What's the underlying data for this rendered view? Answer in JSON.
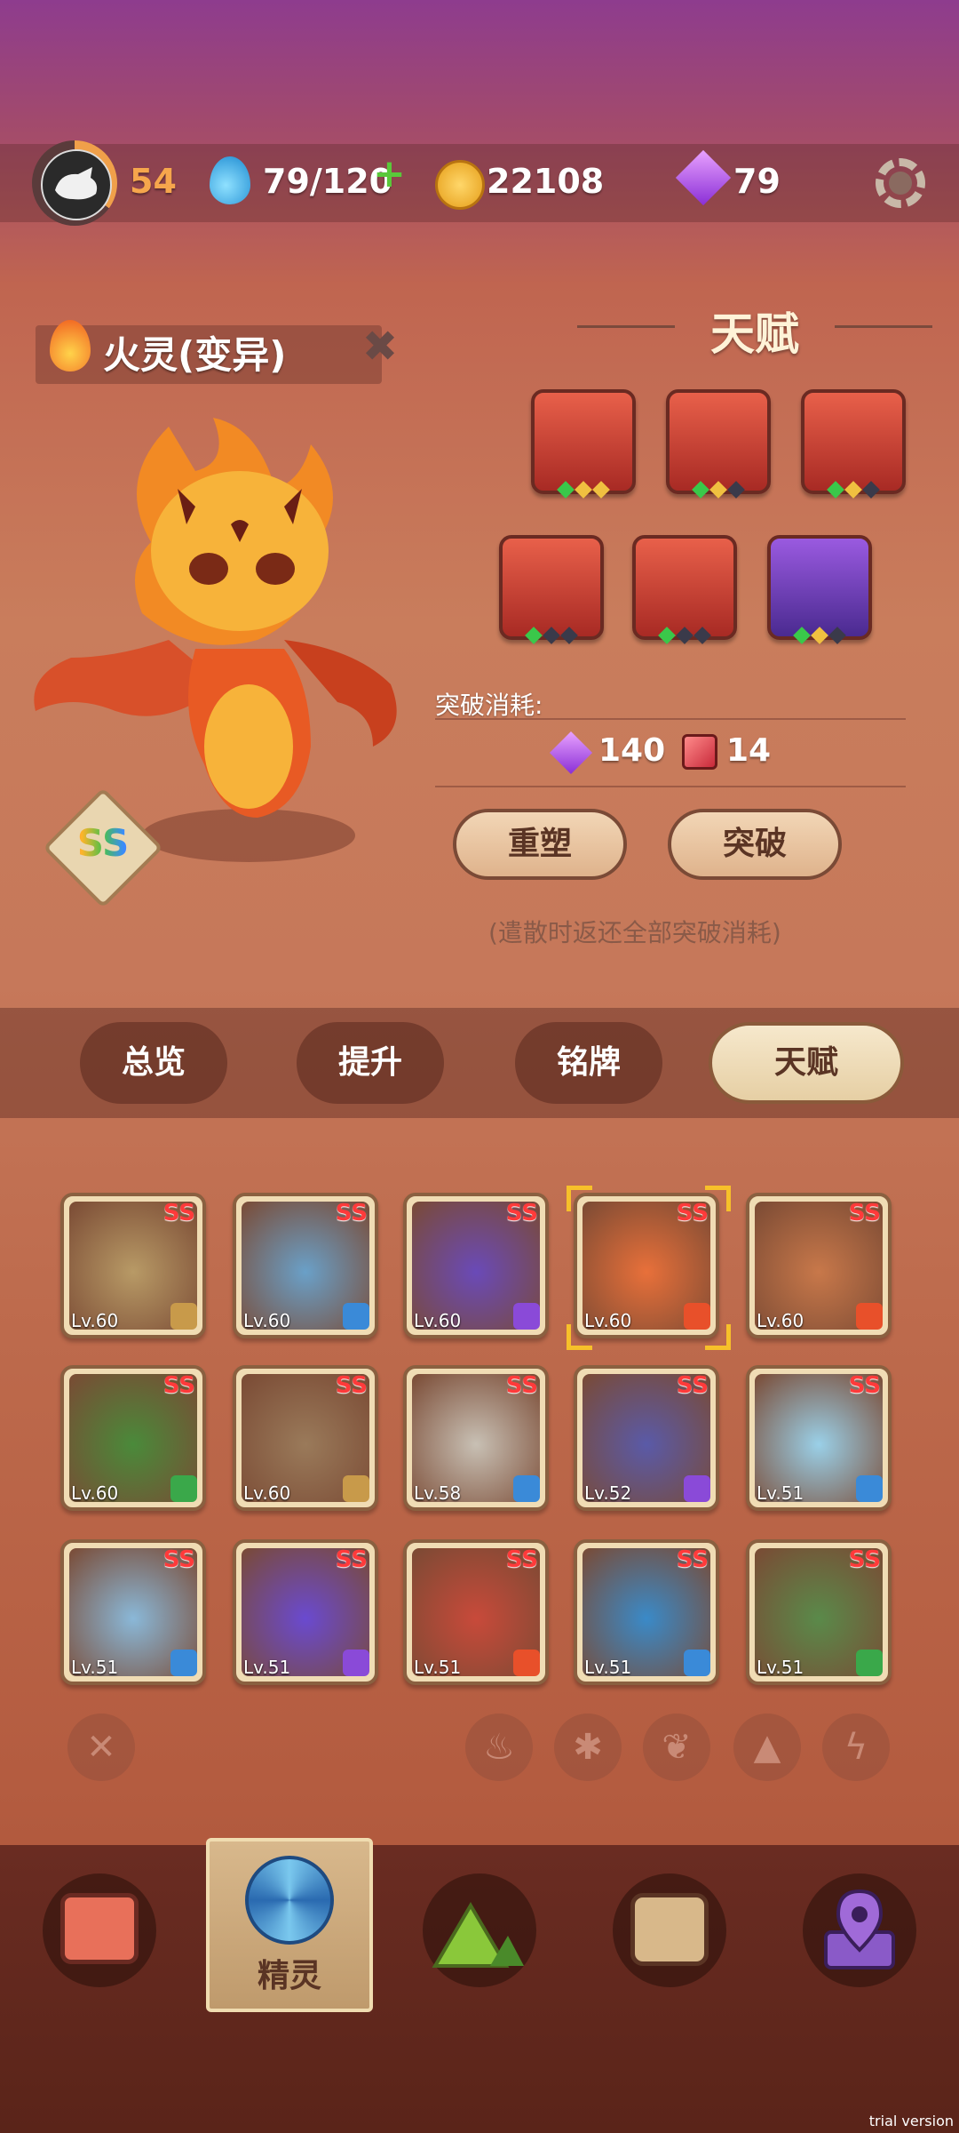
{
  "hud": {
    "level": "54",
    "energy": "79/120",
    "coins": "22108",
    "gems": "79"
  },
  "pet": {
    "name": "火灵(变异)",
    "rank": "SS"
  },
  "talent": {
    "title": "天赋",
    "icons": [
      {
        "name": "spiral",
        "dots": [
          "g",
          "y",
          "y"
        ],
        "color": "red"
      },
      {
        "name": "heart",
        "dots": [
          "g",
          "y",
          "n"
        ],
        "color": "red"
      },
      {
        "name": "fang",
        "dots": [
          "g",
          "y",
          "n"
        ],
        "color": "red"
      },
      {
        "name": "broken-heart",
        "dots": [
          "g",
          "n",
          "n"
        ],
        "color": "red"
      },
      {
        "name": "slash",
        "dots": [
          "g",
          "n",
          "n"
        ],
        "color": "red"
      },
      {
        "name": "lightning",
        "dots": [
          "g",
          "y",
          "n"
        ],
        "color": "purple"
      }
    ],
    "cost_label": "突破消耗:",
    "cost_gems": "140",
    "cost_books": "14",
    "reset_label": "重塑",
    "breakthrough_label": "突破",
    "hint": "(遣散时返还全部突破消耗)"
  },
  "tabs": [
    "总览",
    "提升",
    "铭牌",
    "天赋"
  ],
  "roster": [
    {
      "lv": "Lv.60",
      "rank": "SS",
      "el": "earth",
      "art": "#b89a66"
    },
    {
      "lv": "Lv.60",
      "rank": "SS",
      "el": "ice",
      "art": "#6aa0c8"
    },
    {
      "lv": "Lv.60",
      "rank": "SS",
      "el": "thunder",
      "art": "#6a4ab8"
    },
    {
      "lv": "Lv.60",
      "rank": "SS",
      "el": "fire",
      "art": "#e8703a",
      "selected": true
    },
    {
      "lv": "Lv.60",
      "rank": "SS",
      "el": "fire",
      "art": "#c8784a"
    },
    {
      "lv": "Lv.60",
      "rank": "SS",
      "el": "grass",
      "art": "#4a8a3a"
    },
    {
      "lv": "Lv.60",
      "rank": "SS",
      "el": "earth",
      "art": "#9a7a5a"
    },
    {
      "lv": "Lv.58",
      "rank": "SS",
      "el": "ice",
      "art": "#c8c0b4"
    },
    {
      "lv": "Lv.52",
      "rank": "SS",
      "el": "thunder",
      "art": "#5a5aa8"
    },
    {
      "lv": "Lv.51",
      "rank": "SS",
      "el": "ice",
      "art": "#9ad0e8"
    },
    {
      "lv": "Lv.51",
      "rank": "SS",
      "el": "ice",
      "art": "#8ab8d8"
    },
    {
      "lv": "Lv.51",
      "rank": "SS",
      "el": "thunder",
      "art": "#6a4ad0"
    },
    {
      "lv": "Lv.51",
      "rank": "SS",
      "el": "fire",
      "art": "#c84a3a"
    },
    {
      "lv": "Lv.51",
      "rank": "SS",
      "el": "ice",
      "art": "#3a8ac8"
    },
    {
      "lv": "Lv.51",
      "rank": "SS",
      "el": "grass",
      "art": "#5a8a4a"
    }
  ],
  "filters": [
    "fire-icon",
    "snowflake-icon",
    "leaf-icon",
    "rock-icon",
    "lightning-icon"
  ],
  "nav": {
    "active_label": "精灵"
  },
  "watermark": "trial version",
  "colors": {
    "fire": "#e8502a",
    "ice": "#3a8ad8",
    "thunder": "#8a4ad8",
    "grass": "#3aa84a",
    "earth": "#c89a4a"
  }
}
